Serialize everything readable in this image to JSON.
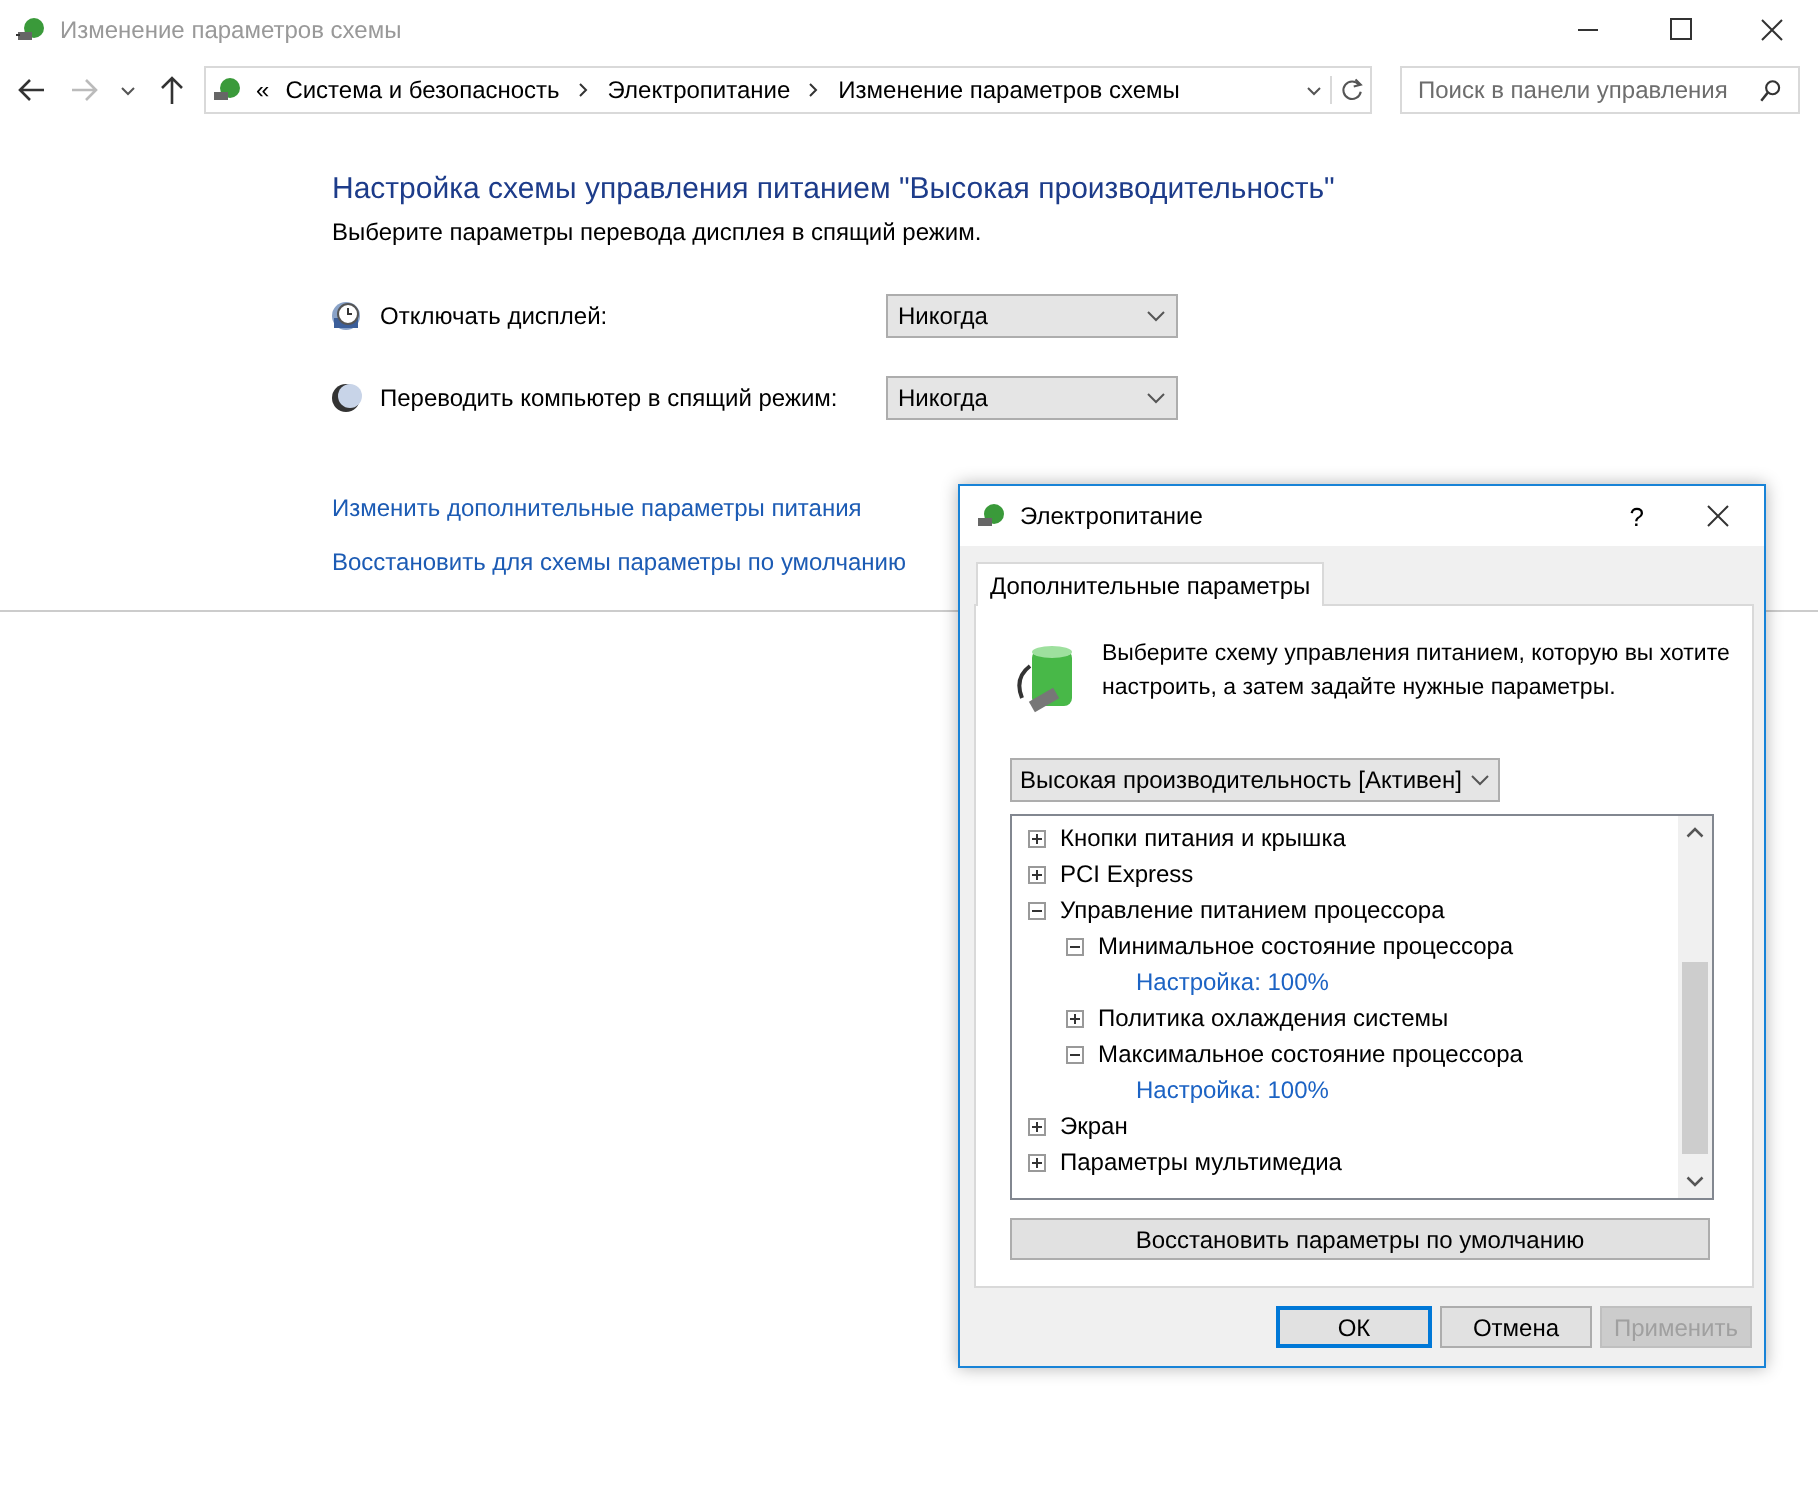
{
  "window": {
    "title": "Изменение параметров схемы"
  },
  "address_bar": {
    "prefix": "«",
    "crumbs": [
      "Система и безопасность",
      "Электропитание",
      "Изменение параметров схемы"
    ]
  },
  "search": {
    "placeholder": "Поиск в панели управления"
  },
  "heading": "Настройка схемы управления питанием \"Высокая производительность\"",
  "subheading": "Выберите параметры перевода дисплея в спящий режим.",
  "settings": [
    {
      "kind": "display",
      "label": "Отключать дисплей:",
      "value": "Никогда"
    },
    {
      "kind": "sleep",
      "label": "Переводить компьютер в спящий режим:",
      "value": "Никогда"
    }
  ],
  "links": [
    "Изменить дополнительные параметры питания",
    "Восстановить для схемы параметры по умолчанию"
  ],
  "dialog": {
    "title": "Электропитание",
    "help": "?",
    "tabs": [
      {
        "label": "Дополнительные параметры",
        "selected": true
      }
    ],
    "intro": "Выберите схему управления питанием, которую вы хотите настроить, а затем задайте нужные параметры.",
    "plan": "Высокая производительность [Активен]",
    "tree": [
      {
        "label": "Кнопки питания и крышка",
        "expanded": false
      },
      {
        "label": "PCI Express",
        "expanded": false
      },
      {
        "label": "Управление питанием процессора",
        "expanded": true,
        "children": [
          {
            "label": "Минимальное состояние процессора",
            "expanded": true,
            "children": [
              {
                "kind": "value",
                "label": "Настройка: 100%"
              }
            ]
          },
          {
            "label": "Политика охлаждения системы",
            "expanded": false
          },
          {
            "label": "Максимальное состояние процессора",
            "expanded": true,
            "children": [
              {
                "kind": "value",
                "label": "Настройка: 100%"
              }
            ]
          }
        ]
      },
      {
        "label": "Экран",
        "expanded": false
      },
      {
        "label": "Параметры мультимедиа",
        "expanded": false
      }
    ],
    "restore": "Восстановить параметры по умолчанию",
    "buttons": [
      {
        "label": "ОК",
        "default": true,
        "disabled": false
      },
      {
        "label": "Отмена",
        "default": false,
        "disabled": false
      },
      {
        "label": "Применить",
        "default": false,
        "disabled": true
      }
    ]
  }
}
